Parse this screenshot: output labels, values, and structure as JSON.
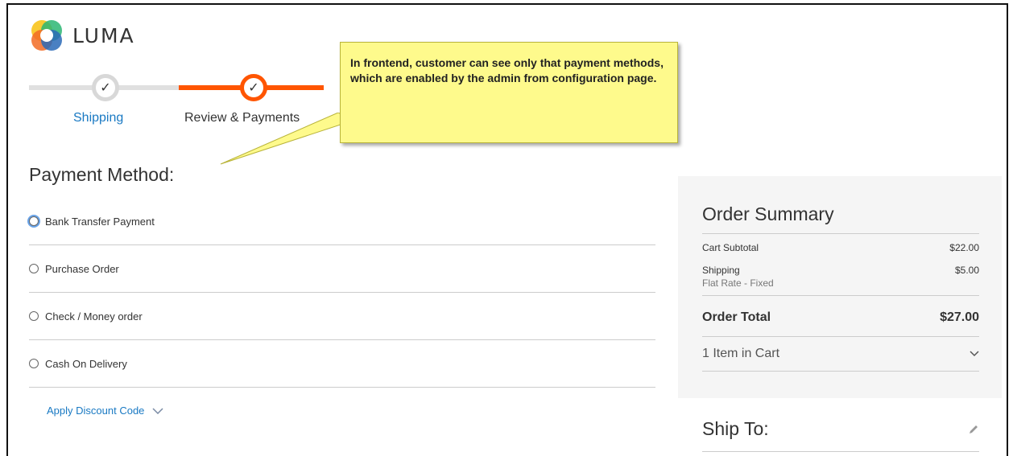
{
  "brand": {
    "name": "LUMA"
  },
  "progress": {
    "steps": [
      {
        "label": "Shipping",
        "done": true
      },
      {
        "label": "Review & Payments",
        "done": true,
        "current": true
      }
    ],
    "check_glyph": "✓"
  },
  "callout": {
    "text": "In frontend, customer can see only that payment methods, which are enabled by the admin from configuration page."
  },
  "payment": {
    "title": "Payment Method:",
    "methods": [
      {
        "label": "Bank Transfer Payment",
        "focused": true
      },
      {
        "label": "Purchase Order"
      },
      {
        "label": "Check / Money order"
      },
      {
        "label": "Cash On Delivery"
      }
    ],
    "discount_label": "Apply Discount Code"
  },
  "summary": {
    "title": "Order Summary",
    "cart_subtotal_label": "Cart Subtotal",
    "cart_subtotal_value": "$22.00",
    "shipping_label": "Shipping",
    "shipping_value": "$5.00",
    "shipping_method": "Flat Rate - Fixed",
    "order_total_label": "Order Total",
    "order_total_value": "$27.00",
    "items_in_cart": "1 Item in Cart"
  },
  "ship_to": {
    "title": "Ship To:"
  },
  "colors": {
    "accent_orange": "#ff5501",
    "link_blue": "#1979c3",
    "callout_yellow": "#fefa8c"
  },
  "icons": {
    "logo": "luma-logo-icon",
    "chevron": "chevron-down-icon",
    "edit": "pencil-icon"
  }
}
